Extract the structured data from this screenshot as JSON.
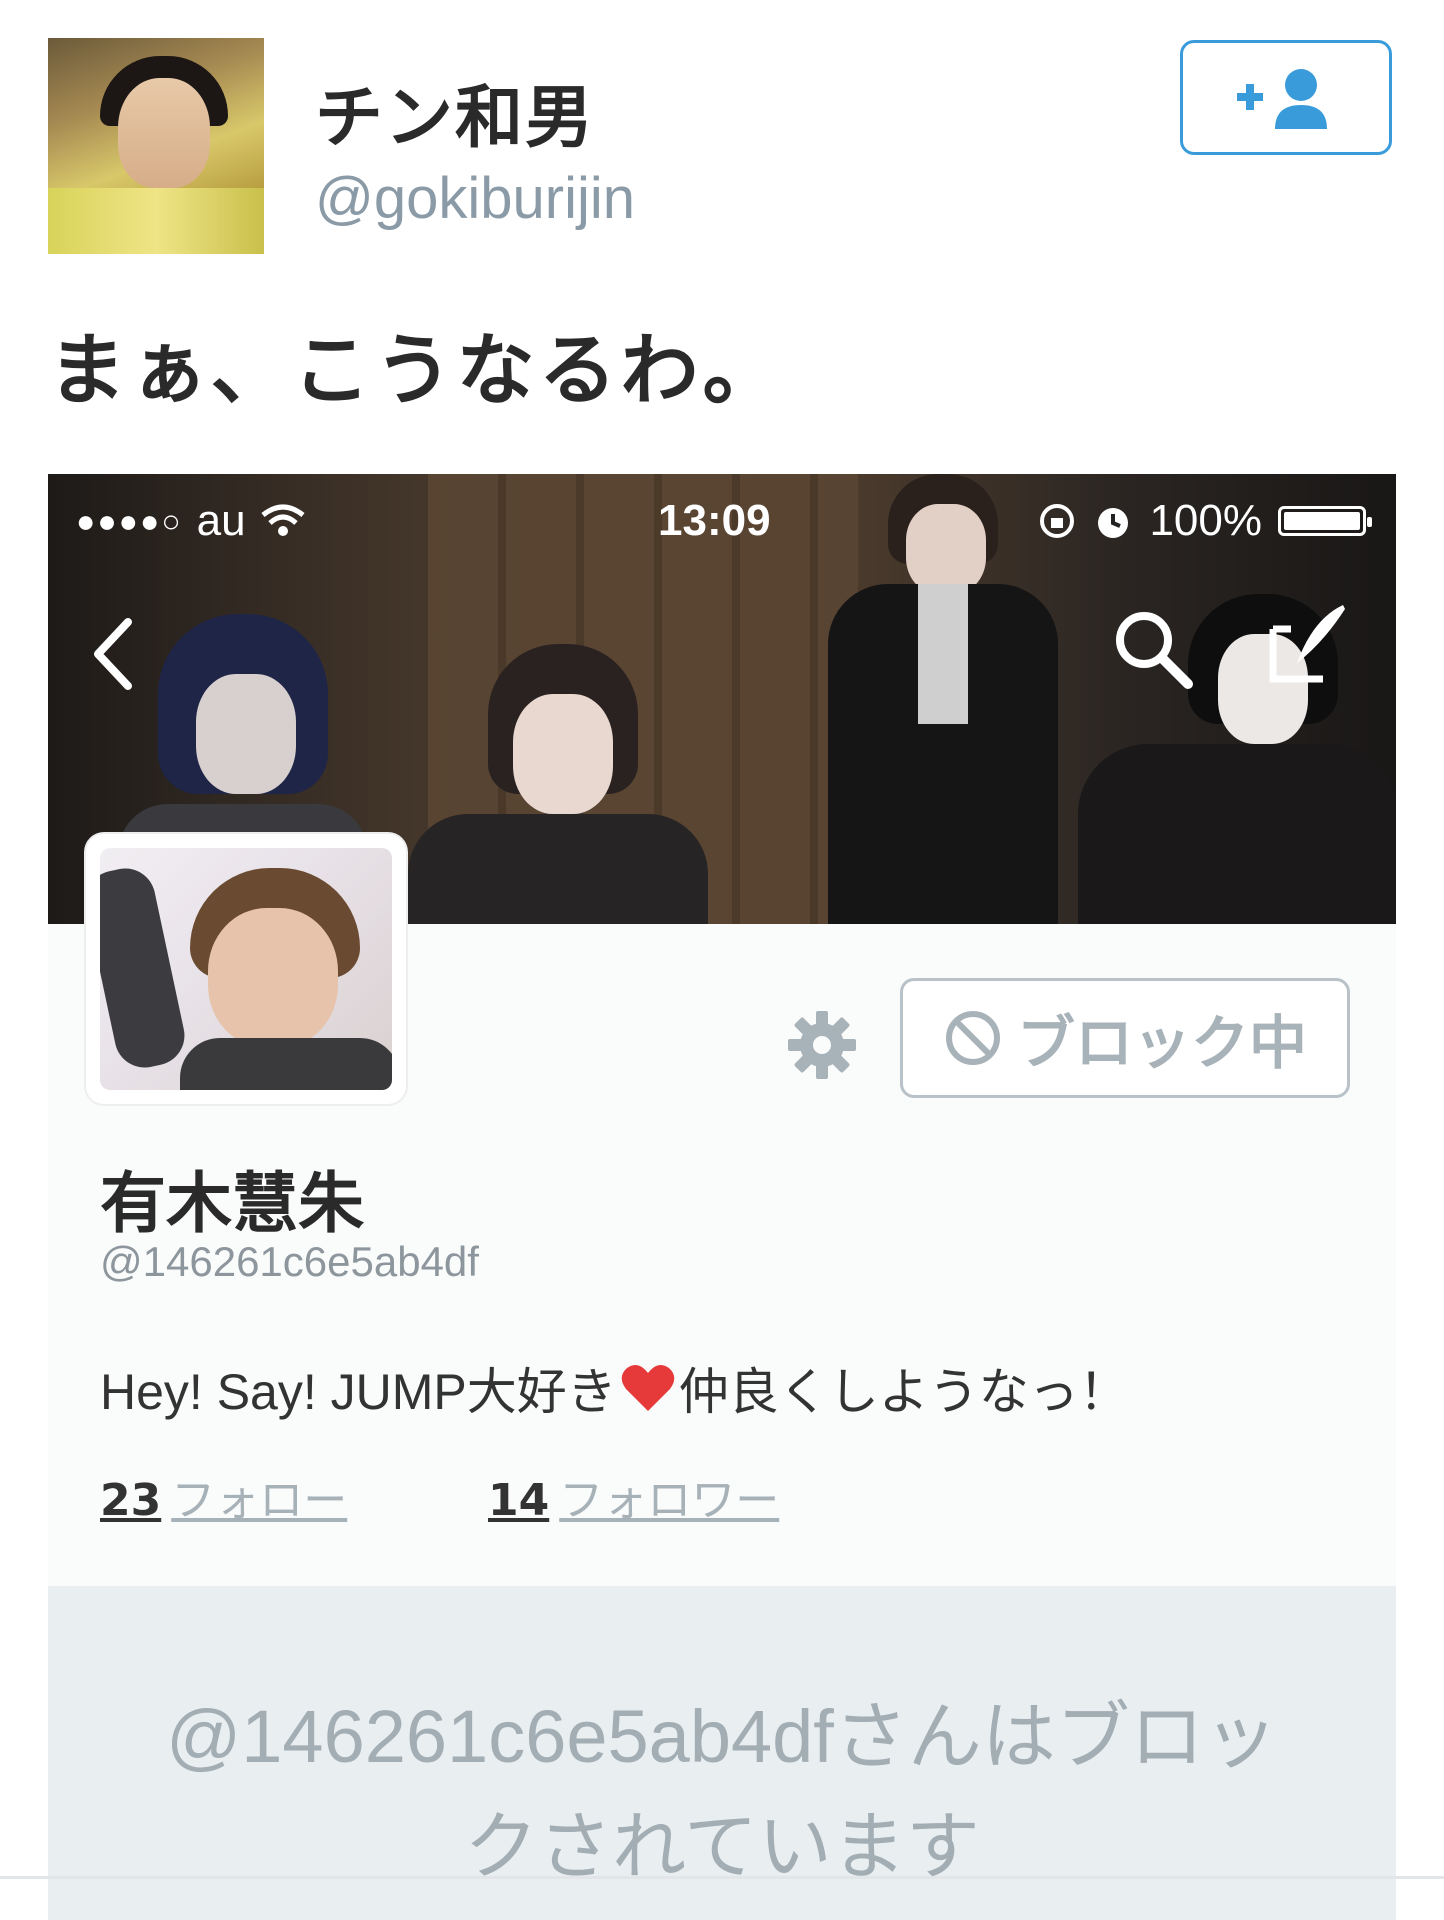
{
  "tweet": {
    "author_name": "チン和男",
    "author_handle": "@gokiburijin",
    "text": "まぁ、こうなるわ。"
  },
  "screenshot": {
    "status_bar": {
      "carrier": "au",
      "time": "13:09",
      "battery": "100%",
      "battery_level": 1.0
    },
    "profile": {
      "name": "有木慧朱",
      "handle": "@146261c6e5ab4df",
      "bio_before_heart": "Hey! Say! JUMP大好き",
      "bio_after_heart": "仲良くしようなっ！",
      "following_count": "23",
      "following_label": "フォロー",
      "followers_count": "14",
      "followers_label": "フォロワー",
      "block_button_label": "ブロック中"
    },
    "blocked_message_line1": "@146261c6e5ab4dfさんはブロッ",
    "blocked_message_line2": "クされています"
  },
  "colors": {
    "accent": "#3a9bdb",
    "muted": "#a2adb4"
  }
}
